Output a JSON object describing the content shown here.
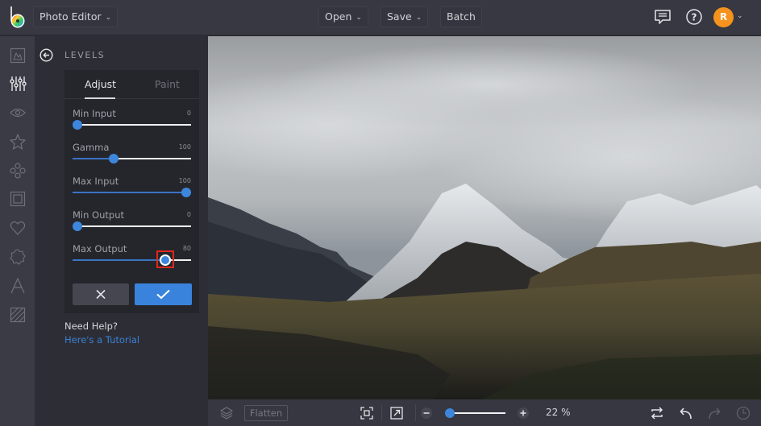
{
  "topbar": {
    "app_menu_label": "Photo Editor",
    "open_label": "Open",
    "save_label": "Save",
    "batch_label": "Batch",
    "avatar_initial": "R",
    "icons": {
      "logo": "befunky-logo-icon",
      "comments": "comments-icon",
      "help": "help-icon",
      "chevron": "chevron-down-icon"
    }
  },
  "rail": {
    "items": [
      {
        "name": "image-manager",
        "icon": "image-icon",
        "active": false
      },
      {
        "name": "edit",
        "icon": "sliders-icon",
        "active": true
      },
      {
        "name": "touch-up",
        "icon": "eye-icon",
        "active": false
      },
      {
        "name": "effects",
        "icon": "star-icon",
        "active": false
      },
      {
        "name": "artsy",
        "icon": "flower-icon",
        "active": false
      },
      {
        "name": "frames",
        "icon": "frame-icon",
        "active": false
      },
      {
        "name": "graphics",
        "icon": "heart-icon",
        "active": false
      },
      {
        "name": "overlays",
        "icon": "badge-icon",
        "active": false
      },
      {
        "name": "text",
        "icon": "text-icon",
        "active": false
      },
      {
        "name": "textures",
        "icon": "texture-icon",
        "active": false
      }
    ]
  },
  "panel": {
    "title": "LEVELS",
    "tabs": [
      {
        "label": "Adjust",
        "active": true
      },
      {
        "label": "Paint",
        "active": false
      }
    ],
    "sliders": [
      {
        "label": "Min Input",
        "value": "0",
        "fraction": 0.04
      },
      {
        "label": "Gamma",
        "value": "100",
        "fraction": 0.35
      },
      {
        "label": "Max Input",
        "value": "100",
        "fraction": 0.96
      },
      {
        "label": "Min Output",
        "value": "0",
        "fraction": 0.04
      },
      {
        "label": "Max Output",
        "value": "80",
        "fraction": 0.78,
        "focused": true
      }
    ],
    "cancel_icon": "close-icon",
    "apply_icon": "checkmark-icon",
    "help_title": "Need Help?",
    "help_link": "Here's a Tutorial"
  },
  "bottombar": {
    "flatten_label": "Flatten",
    "zoom_value": "22 %",
    "zoom_fraction": 0.0,
    "icons": [
      "layers-icon",
      "fit-to-screen-icon",
      "actual-size-icon",
      "zoom-out-icon",
      "zoom-in-icon",
      "compare-icon",
      "undo-icon",
      "redo-icon",
      "history-icon"
    ]
  },
  "colors": {
    "accent": "#3a83dc",
    "avatar": "#f5931d",
    "focus_outline": "#e0281c",
    "link": "#3a80d6"
  }
}
